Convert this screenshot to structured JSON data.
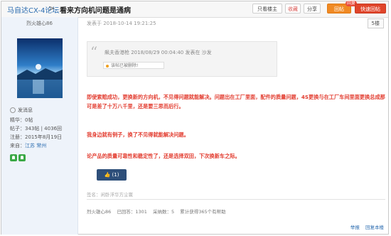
{
  "header": {
    "forum_name": "马自达CX-4论坛",
    "separator": ">",
    "thread_title": "看来方向机问题是通病",
    "buttons": {
      "only_owner": "只看楼主",
      "favorite": "收藏",
      "share": "分享",
      "reply": "回帖",
      "quick_reply": "快速回帖",
      "new_badge": "回复"
    }
  },
  "profile": {
    "username": "烈火雄心86",
    "send_message": "发消息",
    "essence": "精华：0帖",
    "posts": "帖子：343帖 | 4036回",
    "registered": "注册：2015年8月19日",
    "location_label": "来自：",
    "location": "江苏 常州"
  },
  "post": {
    "posted_at": "发表于 2018-10-14 19:21:25",
    "floor": "5楼",
    "quote": {
      "author_line": "飙夫香港枪 2018/08/29 00:04:40 发表在 沙发",
      "deleted_notice": "该帖已被删除!"
    },
    "paragraphs": [
      "即使索赔成功，更换新的方向机，不见得问题就能解决。问题出在工厂里面，配件的质量问题，4S更换与在工厂车间里面更换总成那可是差了十万八千里，还是要三思而后行。",
      "我身边就有例子，换了不见得就能解决问题。",
      "论产品的质量可靠性和稳定性了，还是选择双田，下次换新车之际。"
    ],
    "like_label": "(1)",
    "signature": "签名：闲卧浮华方尘寰",
    "stats": {
      "user": "烈火雄心86",
      "level": "已回答：1301",
      "points": "采纳数：5",
      "liked": "累计获得365个有帮助"
    },
    "footer_links": [
      "举报",
      "回复本楼"
    ]
  },
  "colors": {
    "accent_red": "#e23b2e",
    "link_blue": "#2b6cb0",
    "reply_orange": "#f08a24"
  }
}
